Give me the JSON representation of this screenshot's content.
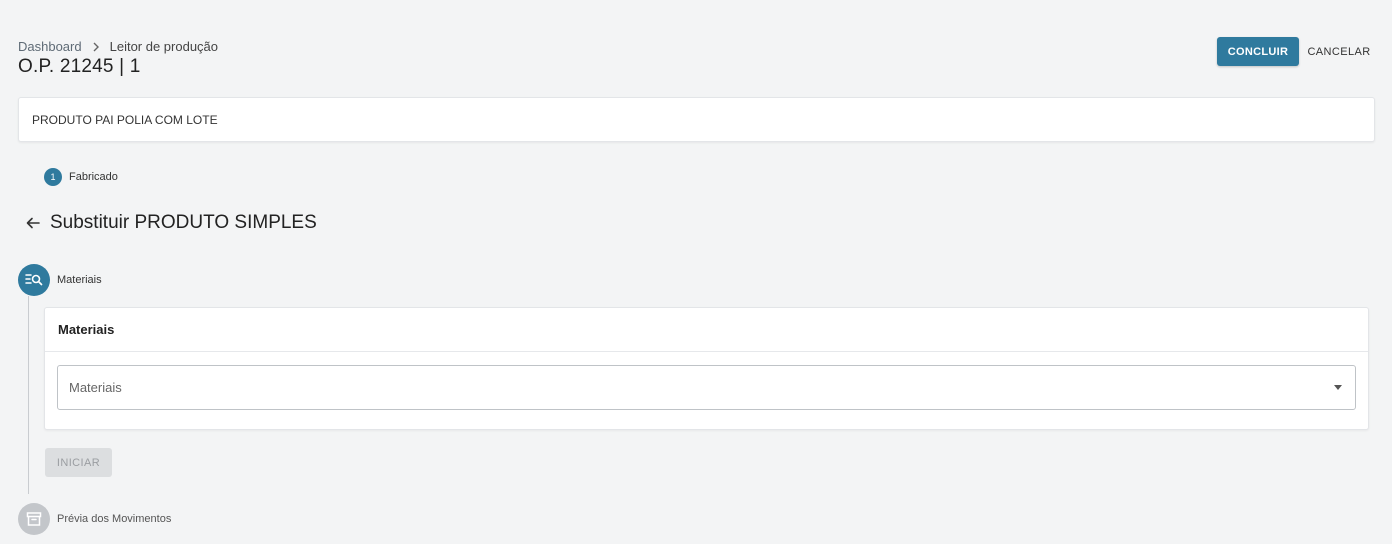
{
  "breadcrumb": {
    "home": "Dashboard",
    "current": "Leitor de produção"
  },
  "header": {
    "title": "O.P. 21245 | 1",
    "concluir_label": "CONCLUIR",
    "cancelar_label": "CANCELAR"
  },
  "product": {
    "name": "PRODUTO PAI POLIA COM LOTE"
  },
  "top_step": {
    "number": "1",
    "label": "Fabricado"
  },
  "section": {
    "title": "Substituir PRODUTO SIMPLES"
  },
  "steps": [
    {
      "label": "Materiais",
      "icon": "list-search-icon",
      "state": "active"
    },
    {
      "label": "Prévia dos Movimentos",
      "icon": "archive-icon",
      "state": "inactive"
    }
  ],
  "materials_card": {
    "title": "Materiais",
    "select_placeholder": "Materiais"
  },
  "iniciar_label": "INICIAR",
  "colors": {
    "primary": "#2f7a9e",
    "background": "#f3f4f5",
    "disabled": "#dcdee0"
  }
}
